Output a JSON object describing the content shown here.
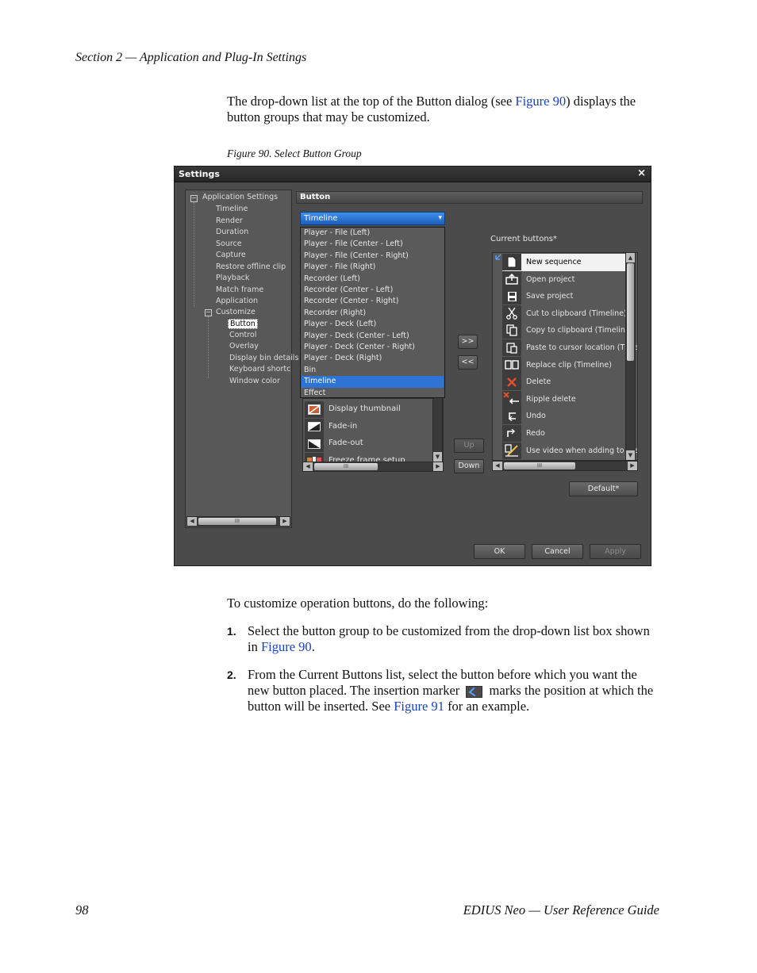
{
  "page": {
    "header": "Section 2 — Application and Plug-In Settings",
    "intro_before_link": "The drop-down list at the top of the Button dialog (see ",
    "intro_link": "Figure 90",
    "intro_after_link": ") displays the button groups that may be customized.",
    "figure_caption": "Figure 90.  Select Button Group",
    "steps_intro": "To customize operation buttons, do the following:",
    "steps": [
      {
        "number": "1.",
        "text_before_link": "Select the button group to be customized from the drop-down list box shown in ",
        "link": "Figure 90",
        "text_after_link": "."
      },
      {
        "number": "2.",
        "text_before_marker": "From the Current Buttons list, select the button before which you want the new button placed. The insertion marker",
        "text_after_marker": "marks the position at which the button will be inserted. See ",
        "link": "Figure 91",
        "text_after_link": " for an example."
      }
    ],
    "footer_left": "98",
    "footer_right": "EDIUS Neo  —  User Reference Guide",
    "link_color": "#1a3fc7"
  },
  "dialog": {
    "title": "Settings",
    "close": "×",
    "tree": {
      "root": "Application Settings",
      "items": [
        "Timeline",
        "Render",
        "Duration",
        "Source",
        "Capture",
        "Restore offline clip",
        "Playback",
        "Match frame",
        "Application"
      ],
      "customize": "Customize",
      "customize_items": [
        "Button",
        "Control",
        "Overlay",
        "Display bin details",
        "Keyboard shortcut",
        "Window color"
      ],
      "selected": "Button",
      "expand_icon": "−",
      "scroll_thumb": "III"
    },
    "section_title": "Button",
    "group_select": {
      "value": "Timeline",
      "arrow": "▾"
    },
    "dropdown_options": [
      "Player - File (Left)",
      "Player - File (Center - Left)",
      "Player - File (Center - Right)",
      "Player - File (Right)",
      "Recorder (Left)",
      "Recorder (Center - Left)",
      "Recorder (Center - Right)",
      "Recorder (Right)",
      "Player - Deck (Left)",
      "Player - Deck (Center - Left)",
      "Player - Deck (Center - Right)",
      "Player - Deck (Right)",
      "Bin",
      "Timeline",
      "Effect"
    ],
    "dropdown_selected_index": 13,
    "available_buttons": [
      {
        "label": "Display thumbnail",
        "icon": "display-thumbnail-icon"
      },
      {
        "label": "Fade-in",
        "icon": "fade-in-icon"
      },
      {
        "label": "Fade-out",
        "icon": "fade-out-icon"
      },
      {
        "label": "Freeze frame setup",
        "icon": "freeze-frame-icon"
      }
    ],
    "add_label": ">>",
    "remove_label": "<<",
    "up_label": "Up",
    "down_label": "Down",
    "current_label": "Current buttons*",
    "current_buttons": [
      {
        "label": "New sequence",
        "icon": "new-sequence-icon"
      },
      {
        "label": "Open project",
        "icon": "open-project-icon"
      },
      {
        "label": "Save project",
        "icon": "save-project-icon"
      },
      {
        "label": "Cut to clipboard (Timeline)",
        "icon": "cut-icon"
      },
      {
        "label": "Copy to clipboard (Timeline)",
        "icon": "copy-icon"
      },
      {
        "label": "Paste to cursor location (Timeline)",
        "icon": "paste-icon"
      },
      {
        "label": "Replace clip (Timeline)",
        "icon": "replace-clip-icon"
      },
      {
        "label": "Delete",
        "icon": "delete-icon"
      },
      {
        "label": "Ripple delete",
        "icon": "ripple-delete-icon"
      },
      {
        "label": "Undo",
        "icon": "undo-icon"
      },
      {
        "label": "Redo",
        "icon": "redo-icon"
      },
      {
        "label": "Use video when adding to the timeline",
        "icon": "use-video-icon"
      }
    ],
    "current_selected_index": 0,
    "default_label": "Default*",
    "ok_label": "OK",
    "cancel_label": "Cancel",
    "apply_label": "Apply",
    "scroll_thumb": "III",
    "colors": {
      "dialog_bg": "#4b4b4b",
      "selection_blue": "#2e73d6",
      "delete_red": "#e2502a"
    }
  }
}
